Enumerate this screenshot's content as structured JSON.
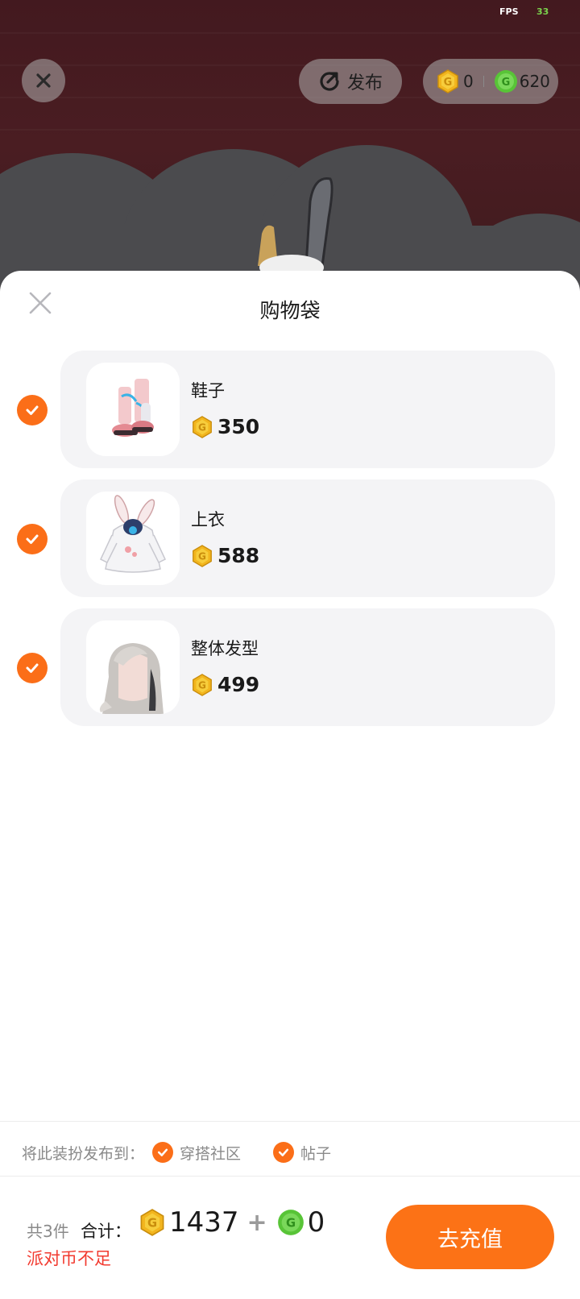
{
  "status": {
    "fps_label": "FPS",
    "fps_value": "33"
  },
  "top_bar": {
    "publish_label": "发布",
    "currency": [
      {
        "icon": "gold-coin-icon",
        "value": "0"
      },
      {
        "icon": "green-coin-icon",
        "value": "620"
      }
    ]
  },
  "sheet": {
    "title": "购物袋",
    "items": [
      {
        "name": "鞋子",
        "price": "350",
        "thumb": "shoes-thumbnail",
        "checked": true
      },
      {
        "name": "上衣",
        "price": "588",
        "thumb": "top-thumbnail",
        "checked": true
      },
      {
        "name": "整体发型",
        "price": "499",
        "thumb": "hairstyle-thumbnail",
        "checked": true
      }
    ]
  },
  "publish_to": {
    "label": "将此装扮发布到：",
    "options": [
      {
        "label": "穿搭社区",
        "checked": true
      },
      {
        "label": "帖子",
        "checked": true
      }
    ]
  },
  "footer": {
    "count": "共3件",
    "total_label": "合计：",
    "gold_total": "1437",
    "plus": "+",
    "green_total": "0",
    "warning": "派对币不足",
    "recharge_label": "去充值"
  },
  "colors": {
    "accent": "#fc7216",
    "warning": "#f23a2f",
    "gold": "#f2b51e",
    "green": "#58c437",
    "scene_bg": "#43191f"
  }
}
